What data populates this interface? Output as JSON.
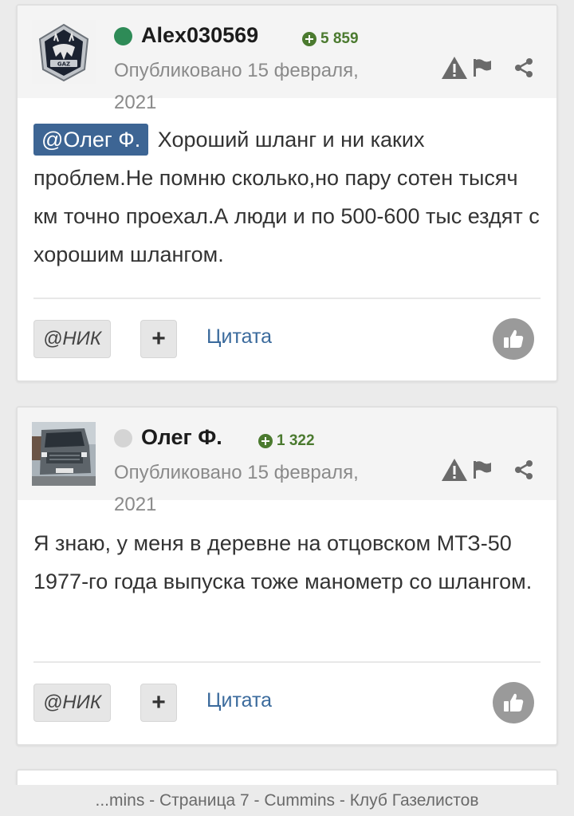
{
  "posts": [
    {
      "username": "Alex030569",
      "online": true,
      "reputation": "5 859",
      "published": "Опубликовано 15 февраля, 2021",
      "mention": "@Олег Ф.",
      "text": "Хороший шланг и ни каких проблем.Не помню сколько,но пару сотен тысяч км точно проехал.А люди и по 500-600 тыс ездят с хорошим шлангом.",
      "mention_button": "@НИК",
      "plus_button": "+",
      "quote_button": "Цитата"
    },
    {
      "username": "Олег Ф.",
      "online": false,
      "reputation": "1 322",
      "published": "Опубликовано 15 февраля, 2021",
      "mention": "",
      "text": "Я знаю, у меня в деревне на отцовском МТЗ-50 1977-го года выпуска тоже манометр со шлангом.",
      "mention_button": "@НИК",
      "plus_button": "+",
      "quote_button": "Цитата"
    }
  ],
  "icons": {
    "reputation": "plus-circle-icon",
    "report": "warning-icon",
    "flag": "flag-icon",
    "share": "share-icon",
    "like": "thumbs-up-icon"
  },
  "colors": {
    "online": "#2e8b57",
    "offline": "#d4d4d4",
    "reputation": "#4b7a2f",
    "mention_bg": "#3d6594",
    "link": "#3a6a9c"
  },
  "footer": {
    "title": "...mins - Страница 7 - Cummins - Клуб Газелистов"
  }
}
